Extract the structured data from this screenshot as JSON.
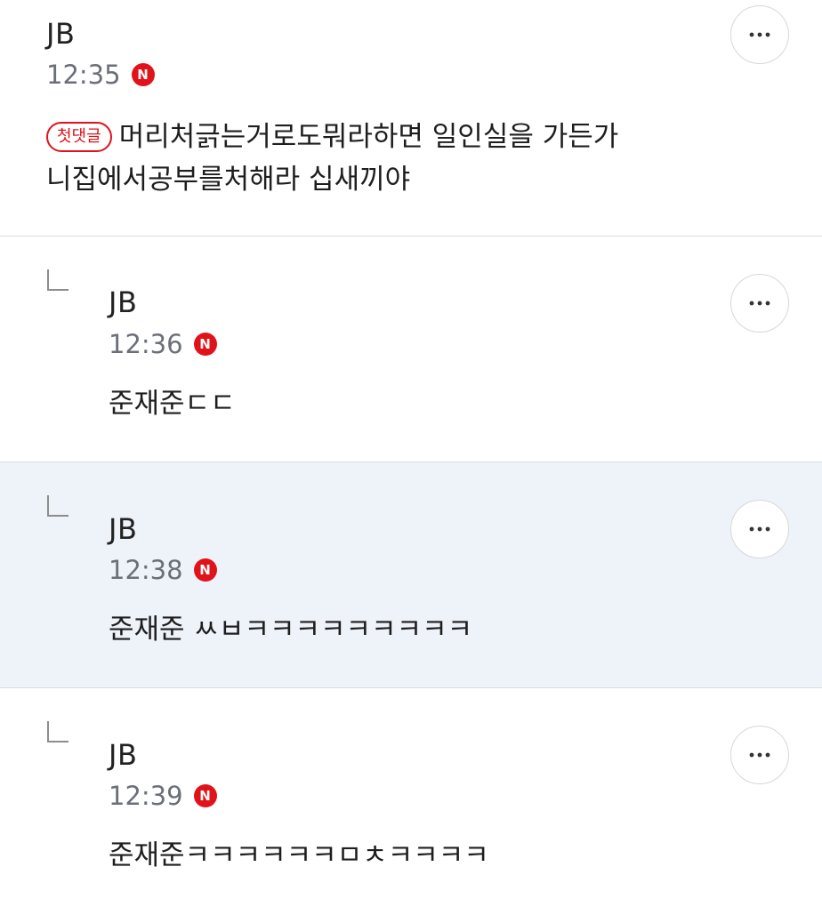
{
  "comments": [
    {
      "author": "JB",
      "time": "12:35",
      "new_badge": "N",
      "first_badge": "첫댓글",
      "text_line1": "머리처긁는거로도뭐라하면 일인실을 가든가",
      "text_line2": "니집에서공부를처해라 십새끼야",
      "more_icon": "more-horizontal-icon"
    },
    {
      "author": "JB",
      "time": "12:36",
      "new_badge": "N",
      "text": "준재준ㄷㄷ",
      "reply_icon": "reply-arrow-icon",
      "more_icon": "more-horizontal-icon"
    },
    {
      "author": "JB",
      "time": "12:38",
      "new_badge": "N",
      "text": "준재준 ㅆㅂㅋㅋㅋㅋㅋㅋㅋㅋㅋ",
      "reply_icon": "reply-arrow-icon",
      "more_icon": "more-horizontal-icon",
      "highlight_color": "#eef2f9"
    },
    {
      "author": "JB",
      "time": "12:39",
      "new_badge": "N",
      "text": "준재준ㅋㅋㅋㅋㅋㅋㅁㅊㅋㅋㅋㅋ",
      "reply_icon": "reply-arrow-icon",
      "more_icon": "more-horizontal-icon"
    }
  ],
  "colors": {
    "new_badge": "#e0131a",
    "divider": "#dcdcdc",
    "time": "#6b6f78"
  }
}
